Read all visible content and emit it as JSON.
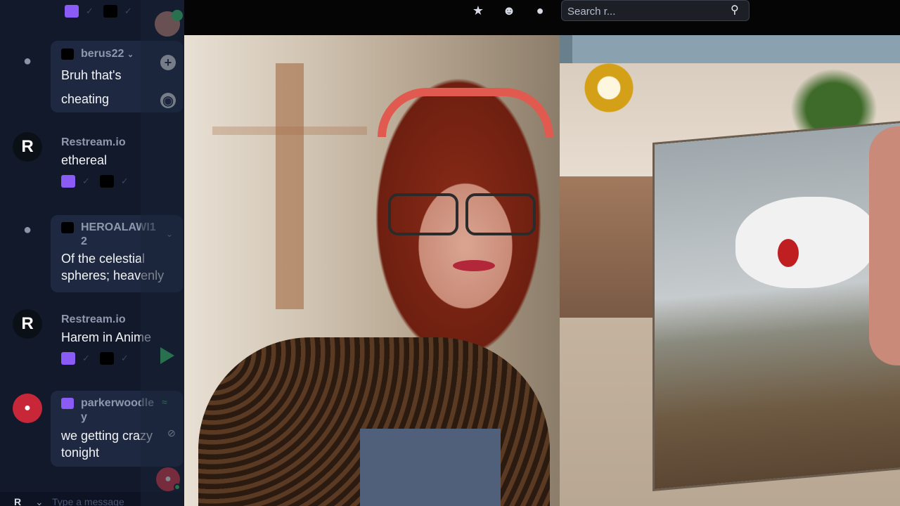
{
  "search": {
    "placeholder": "Search r..."
  },
  "chat": {
    "messages": [
      {
        "username": "berus22",
        "text_lines": [
          "Bruh that's",
          "cheating"
        ],
        "platform": "kick"
      },
      {
        "username": "Restream.io",
        "text": "ethereal",
        "platforms": [
          "twitch",
          "kick"
        ]
      },
      {
        "username_lines": [
          "HEROALAWI1",
          "2"
        ],
        "text_lines": [
          "Of the celestial",
          "spheres; heavenly"
        ],
        "platform": "kick"
      },
      {
        "username": "Restream.io",
        "text": "Harem in Anime",
        "platforms": [
          "twitch",
          "kick"
        ]
      },
      {
        "username_lines": [
          "parkerwoodle",
          "y"
        ],
        "text_lines": [
          "we getting crazy",
          "tonight"
        ],
        "platform": "twitch"
      }
    ],
    "composer_placeholder": "Type a message",
    "avatar_letter": "R"
  },
  "colors": {
    "panel_bg": "#11192b",
    "bubble_bg": "#1e2840",
    "twitch": "#8a5cf5",
    "discord": "#e63946"
  },
  "icons": [
    "pin-icon",
    "add-user-icon",
    "profile-icon",
    "search-icon",
    "plus-icon",
    "compass-icon",
    "discord-icon",
    "stream-icon"
  ]
}
